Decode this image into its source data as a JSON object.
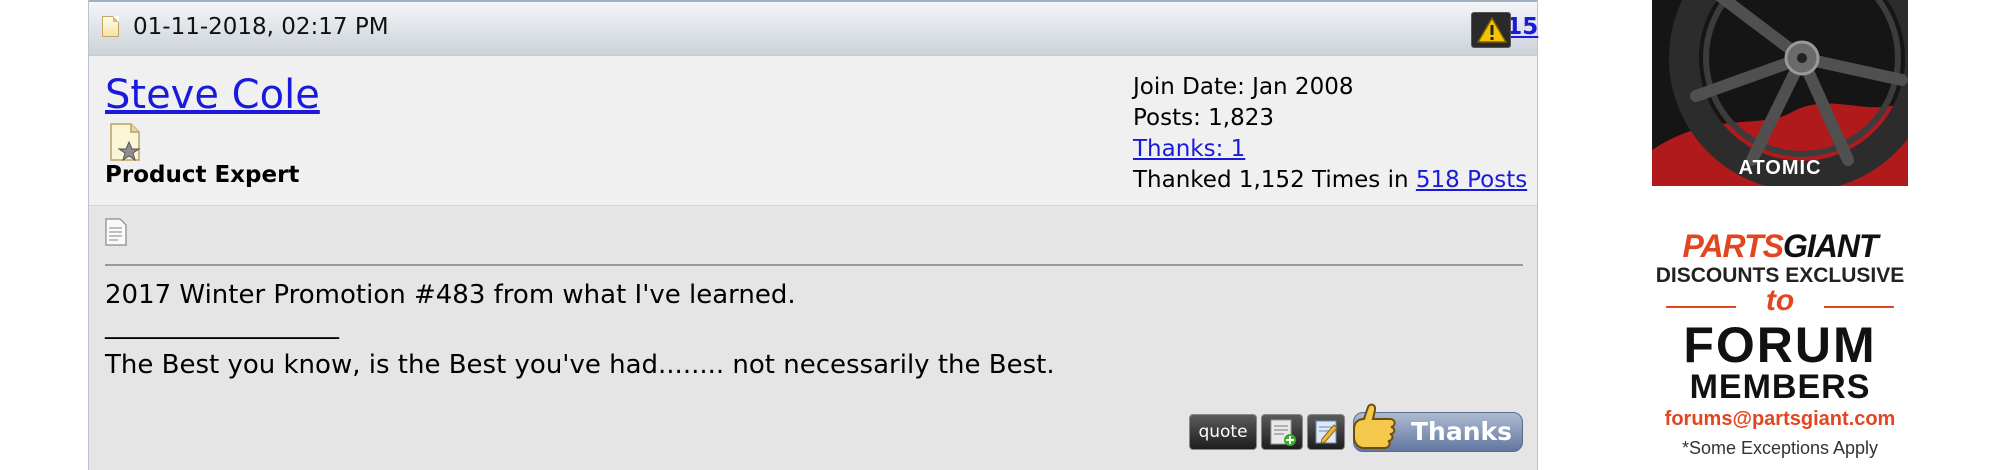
{
  "post": {
    "date": "01-11-2018, 02:17 PM",
    "number_prefix": "#",
    "number": "15",
    "user": {
      "name": "Steve Cole",
      "title": "Product Expert"
    },
    "stats": {
      "join_date": "Join Date: Jan 2008",
      "posts": "Posts: 1,823",
      "thanks_link": "Thanks: 1",
      "thanked_prefix": "Thanked 1,152 Times in ",
      "thanked_link": "518 Posts"
    },
    "message": "2017 Winter Promotion #483 from what I've learned.",
    "signature_rule": "__________________",
    "signature": "The Best you know, is the Best you've had........ not necessarily the Best.",
    "actions": {
      "quote_label": "quote",
      "thanks_label": "Thanks"
    },
    "icons": [
      "post-doc-icon",
      "warning-icon",
      "user-rank-icon",
      "message-icon",
      "multiquote-icon",
      "edit-icon",
      "thumbs-up-icon"
    ]
  },
  "ads": {
    "wheel": {
      "label": "ATOMIC"
    },
    "partsgiant": {
      "brand_part1": "PARTS",
      "brand_part2": "GIANT",
      "line1": "DISCOUNTS EXCLUSIVE",
      "line2": "to",
      "line3": "FORUM",
      "line4": "MEMBERS",
      "email": "forums@partsgiant.com",
      "note": "*Some Exceptions Apply"
    }
  },
  "colors": {
    "link": "#1a1adb",
    "header_bg": "#dbe0e6",
    "body_bg": "#e5e5e5",
    "accent_orange": "#e2451f"
  }
}
